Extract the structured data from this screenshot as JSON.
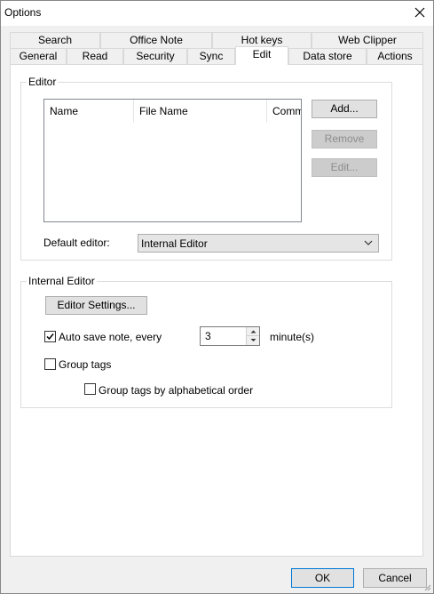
{
  "window": {
    "title": "Options"
  },
  "tabs": {
    "row_back": [
      "Search",
      "Office Note",
      "Hot keys",
      "Web Clipper"
    ],
    "row_front": [
      "General",
      "Read",
      "Security",
      "Sync",
      "Edit",
      "Data store",
      "Actions"
    ],
    "active": "Edit"
  },
  "editor_group": {
    "label": "Editor",
    "columns": [
      "Name",
      "File Name",
      "Comma"
    ],
    "buttons": {
      "add": "Add...",
      "remove": "Remove",
      "edit": "Edit..."
    },
    "default_editor_label": "Default editor:",
    "default_editor_value": "Internal Editor"
  },
  "internal_group": {
    "label": "Internal Editor",
    "settings_button": "Editor Settings...",
    "autosave_label": "Auto save note, every",
    "autosave_checked": true,
    "autosave_value": "3",
    "minutes_label": "minute(s)",
    "group_tags_label": "Group tags",
    "group_tags_checked": false,
    "group_alpha_label": "Group tags by alphabetical order",
    "group_alpha_checked": false
  },
  "footer": {
    "ok": "OK",
    "cancel": "Cancel"
  },
  "colors": {
    "accent": "#0078d7",
    "panel": "#ffffff",
    "background": "#f0f0f0"
  }
}
